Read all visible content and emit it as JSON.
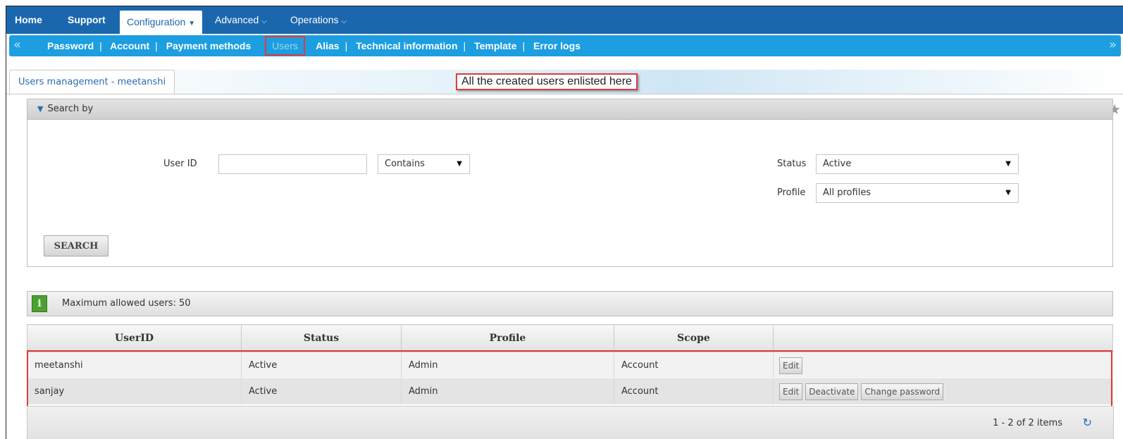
{
  "topnav": {
    "items": [
      "Home",
      "Support",
      "Configuration",
      "Advanced",
      "Operations"
    ]
  },
  "subnav": {
    "links": [
      "Password",
      "Account",
      "Payment methods",
      "Users",
      "Alias",
      "Technical information",
      "Template",
      "Error logs"
    ]
  },
  "tab": {
    "label": "Users management - meetanshi"
  },
  "callout": "All the created users enlisted here",
  "search": {
    "header": "Search by",
    "user_id_label": "User ID",
    "user_id_value": "",
    "match_mode": "Contains",
    "status_label": "Status",
    "status_value": "Active",
    "profile_label": "Profile",
    "profile_value": "All profiles",
    "button": "SEARCH"
  },
  "info": {
    "text": "Maximum allowed users: 50"
  },
  "table": {
    "headers": [
      "UserID",
      "Status",
      "Profile",
      "Scope",
      ""
    ],
    "rows": [
      {
        "userid": "meetanshi",
        "status": "Active",
        "profile": "Admin",
        "scope": "Account",
        "actions": [
          "Edit"
        ]
      },
      {
        "userid": "sanjay",
        "status": "Active",
        "profile": "Admin",
        "scope": "Account",
        "actions": [
          "Edit",
          "Deactivate",
          "Change password"
        ]
      }
    ]
  },
  "pager": "1 - 2 of 2 items",
  "colors": {
    "topnav": "#1b67ad",
    "subnav": "#1c9ee0",
    "highlight": "#e03b3b",
    "info_icon": "#4aa12f"
  }
}
